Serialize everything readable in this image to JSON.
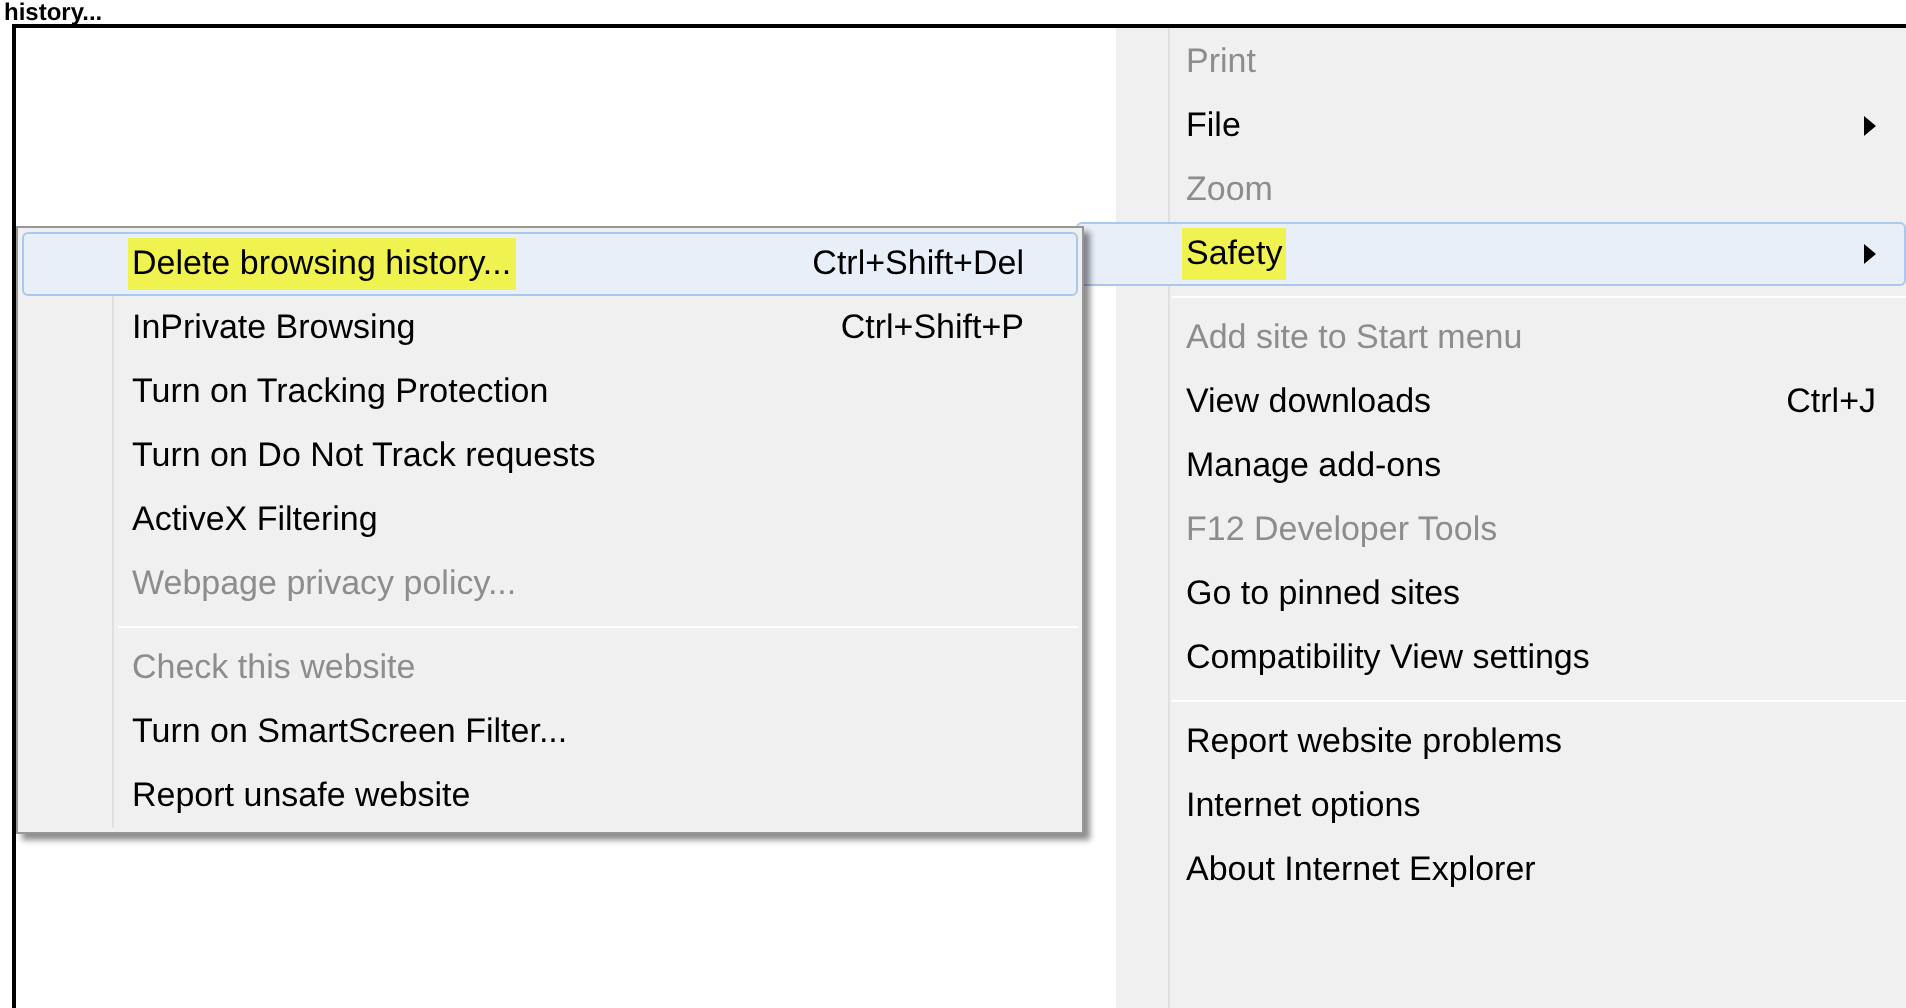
{
  "caption": "history...",
  "menu": {
    "items": [
      {
        "kind": "item",
        "label": "Print",
        "disabled": true,
        "selected": false,
        "highlighted": false,
        "submenu": false
      },
      {
        "kind": "item",
        "label": "File",
        "disabled": false,
        "selected": false,
        "highlighted": false,
        "submenu": true
      },
      {
        "kind": "item",
        "label": "Zoom",
        "disabled": true,
        "selected": false,
        "highlighted": false,
        "submenu": false
      },
      {
        "kind": "item",
        "label": "Safety",
        "disabled": false,
        "selected": true,
        "highlighted": true,
        "submenu": true
      },
      {
        "kind": "separator"
      },
      {
        "kind": "item",
        "label": "Add site to Start menu",
        "disabled": true,
        "selected": false,
        "highlighted": false,
        "submenu": false
      },
      {
        "kind": "item",
        "label": "View downloads",
        "shortcut": "Ctrl+J",
        "disabled": false,
        "selected": false,
        "highlighted": false,
        "submenu": false
      },
      {
        "kind": "item",
        "label": "Manage add-ons",
        "disabled": false,
        "selected": false,
        "highlighted": false,
        "submenu": false
      },
      {
        "kind": "item",
        "label": "F12 Developer Tools",
        "disabled": true,
        "selected": false,
        "highlighted": false,
        "submenu": false
      },
      {
        "kind": "item",
        "label": "Go to pinned sites",
        "disabled": false,
        "selected": false,
        "highlighted": false,
        "submenu": false
      },
      {
        "kind": "item",
        "label": "Compatibility View settings",
        "disabled": false,
        "selected": false,
        "highlighted": false,
        "submenu": false
      },
      {
        "kind": "separator"
      },
      {
        "kind": "item",
        "label": "Report website problems",
        "disabled": false,
        "selected": false,
        "highlighted": false,
        "submenu": false
      },
      {
        "kind": "item",
        "label": "Internet options",
        "disabled": false,
        "selected": false,
        "highlighted": false,
        "submenu": false
      },
      {
        "kind": "item",
        "label": "About Internet Explorer",
        "disabled": false,
        "selected": false,
        "highlighted": false,
        "submenu": false
      }
    ]
  },
  "submenu": {
    "items": [
      {
        "kind": "item",
        "label": "Delete browsing history...",
        "shortcut": "Ctrl+Shift+Del",
        "disabled": false,
        "selected": true,
        "highlighted": true
      },
      {
        "kind": "item",
        "label": "InPrivate Browsing",
        "shortcut": "Ctrl+Shift+P",
        "disabled": false,
        "selected": false,
        "highlighted": false
      },
      {
        "kind": "item",
        "label": "Turn on Tracking Protection",
        "disabled": false,
        "selected": false,
        "highlighted": false
      },
      {
        "kind": "item",
        "label": "Turn on Do Not Track requests",
        "disabled": false,
        "selected": false,
        "highlighted": false
      },
      {
        "kind": "item",
        "label": "ActiveX Filtering",
        "disabled": false,
        "selected": false,
        "highlighted": false
      },
      {
        "kind": "item",
        "label": "Webpage privacy policy...",
        "disabled": true,
        "selected": false,
        "highlighted": false
      },
      {
        "kind": "separator"
      },
      {
        "kind": "item",
        "label": "Check this website",
        "disabled": true,
        "selected": false,
        "highlighted": false
      },
      {
        "kind": "item",
        "label": "Turn on SmartScreen Filter...",
        "disabled": false,
        "selected": false,
        "highlighted": false
      },
      {
        "kind": "item",
        "label": "Report unsafe website",
        "disabled": false,
        "selected": false,
        "highlighted": false
      }
    ]
  }
}
